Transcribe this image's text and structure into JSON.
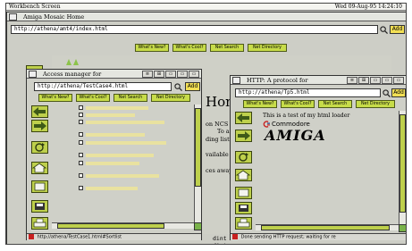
{
  "screen": {
    "title": "Workbench Screen",
    "clock": "Wed 09-Aug-95 14:24:10"
  },
  "main": {
    "title": "Amiga Mosaic Home",
    "url": "http://athena/amt4/index.html",
    "add_label": "Add",
    "nav": [
      "What's New?",
      "What's Cool?",
      "Net Search",
      "Net Directory"
    ],
    "body_heading_fragment": "Hon",
    "body_lines": [
      "on NCS",
      "To a",
      "ding list.",
      "vailable",
      "ces away"
    ],
    "dint_labels": [
      "dint",
      "dint"
    ]
  },
  "access_window": {
    "title": "Access manager for",
    "url": "http://athena/TestCase4.html",
    "add_label": "Add",
    "nav": [
      "What's New?",
      "What's Cool?",
      "Net Search",
      "Net Directory"
    ],
    "status": "http://athena/TestCase1.html#Sortlist"
  },
  "http_window": {
    "title": "HTTP: A protocol for",
    "url": "http://athena/Tp5.html",
    "add_label": "Add",
    "nav": [
      "What's New?",
      "What's Cool?",
      "Net Search",
      "Net Directory"
    ],
    "content_text": "This is a test of my html loader",
    "logo_small": "Commodore",
    "logo_large": "AMIGA",
    "status": "Done sending HTTP request; waiting for re"
  },
  "gadgets": [
    "≡",
    "⊞",
    "▭",
    "▭",
    "▭",
    "▭"
  ],
  "toolbar_icons": [
    "back-arrow-icon",
    "forward-arrow-icon",
    "reload-icon",
    "home-icon",
    "open-icon",
    "save-icon",
    "print-icon"
  ],
  "colors": {
    "nav_green": "#c7dc49",
    "add_yellow": "#f2df54",
    "window_gray": "#cfd0c8"
  }
}
